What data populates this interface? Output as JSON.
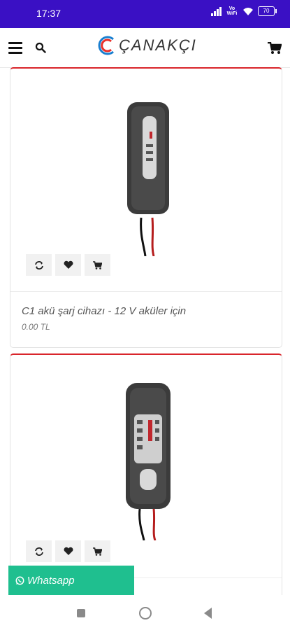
{
  "status_bar": {
    "time": "17:37",
    "network_label": "Vo WiFi",
    "battery": "70"
  },
  "header": {
    "logo_text": "ÇANAKÇI",
    "icons": [
      "menu-icon",
      "search-icon",
      "cart-icon"
    ]
  },
  "products": [
    {
      "name": "C1 akü şarj cihazı - 12 V aküler için",
      "price": "0.00 TL",
      "actions": [
        "compare-icon",
        "heart-icon",
        "cart-icon"
      ]
    },
    {
      "name": "",
      "actions": [
        "compare-icon",
        "heart-icon",
        "cart-icon"
      ]
    }
  ],
  "whatsapp": {
    "label": "Whatsapp"
  },
  "colors": {
    "status_bar": "#3a10c4",
    "card_top_border": "#d9252b",
    "whatsapp": "#1fbf8f"
  }
}
